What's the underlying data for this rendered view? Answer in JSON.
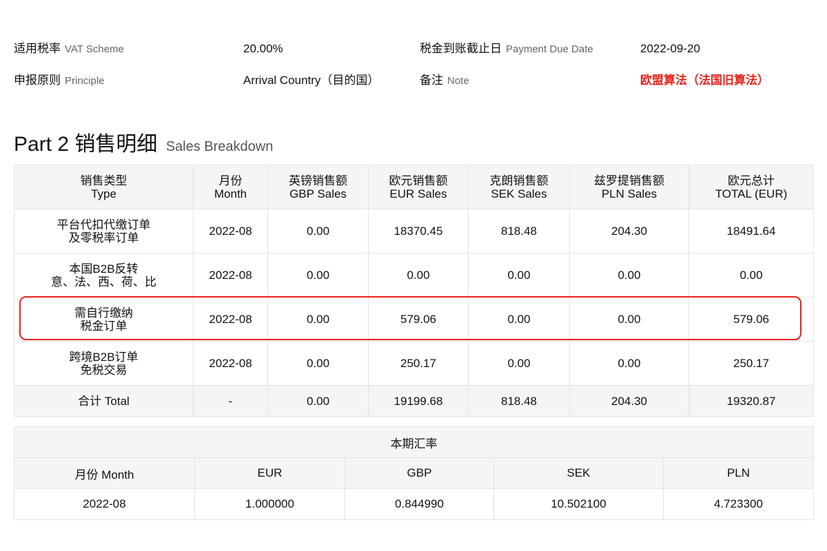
{
  "info": {
    "vat_scheme": {
      "label_zh": "适用税率",
      "label_en": "VAT Scheme",
      "value": "20.00%"
    },
    "due_date": {
      "label_zh": "税金到账截止日",
      "label_en": "Payment Due Date",
      "value": "2022-09-20"
    },
    "principle": {
      "label_zh": "申报原则",
      "label_en": "Principle",
      "value": "Arrival Country（目的国）"
    },
    "note": {
      "label_zh": "备注",
      "label_en": "Note",
      "value": "欧盟算法（法国旧算法）"
    }
  },
  "part2": {
    "title": "Part 2 销售明细",
    "subtitle": "Sales Breakdown"
  },
  "sales_table": {
    "headers": [
      {
        "zh": "销售类型",
        "en": "Type"
      },
      {
        "zh": "月份",
        "en": "Month"
      },
      {
        "zh": "英镑销售额",
        "en": "GBP Sales"
      },
      {
        "zh": "欧元销售额",
        "en": "EUR Sales"
      },
      {
        "zh": "克朗销售额",
        "en": "SEK Sales"
      },
      {
        "zh": "兹罗提销售额",
        "en": "PLN Sales"
      },
      {
        "zh": "欧元总计",
        "en": "TOTAL (EUR)"
      }
    ],
    "rows": [
      {
        "type_l1": "平台代扣代缴订单",
        "type_l2": "及零税率订单",
        "month": "2022-08",
        "gbp": "0.00",
        "eur": "18370.45",
        "sek": "818.48",
        "pln": "204.30",
        "total": "18491.64"
      },
      {
        "type_l1": "本国B2B反转",
        "type_l2": "意、法、西、荷、比",
        "month": "2022-08",
        "gbp": "0.00",
        "eur": "0.00",
        "sek": "0.00",
        "pln": "0.00",
        "total": "0.00"
      },
      {
        "type_l1": "需自行缴纳",
        "type_l2": "税金订单",
        "month": "2022-08",
        "gbp": "0.00",
        "eur": "579.06",
        "sek": "0.00",
        "pln": "0.00",
        "total": "579.06"
      },
      {
        "type_l1": "跨境B2B订单",
        "type_l2": "免税交易",
        "month": "2022-08",
        "gbp": "0.00",
        "eur": "250.17",
        "sek": "0.00",
        "pln": "0.00",
        "total": "250.17"
      }
    ],
    "total_row": {
      "label": "合计 Total",
      "month": "-",
      "gbp": "0.00",
      "eur": "19199.68",
      "sek": "818.48",
      "pln": "204.30",
      "total": "19320.87"
    }
  },
  "rate_table": {
    "title": "本期汇率",
    "headers": [
      "月份 Month",
      "EUR",
      "GBP",
      "SEK",
      "PLN"
    ],
    "row": {
      "month": "2022-08",
      "eur": "1.000000",
      "gbp": "0.844990",
      "sek": "10.502100",
      "pln": "4.723300"
    }
  },
  "colors": {
    "highlight": "#e8231b",
    "note_value": "#e8231b",
    "header_bg": "#f5f5f5",
    "border": "#e3e3e3"
  }
}
